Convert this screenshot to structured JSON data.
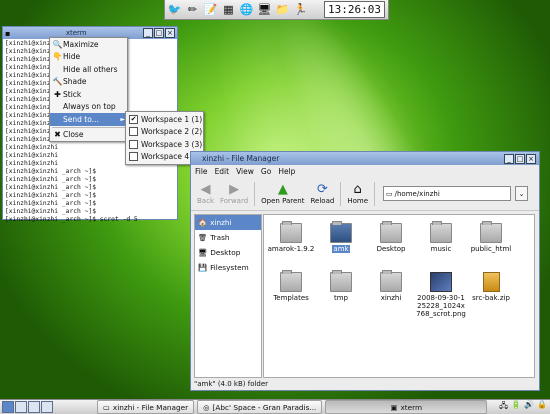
{
  "top_panel": {
    "launchers": [
      {
        "name": "bird-icon",
        "glyph": "🐦"
      },
      {
        "name": "pencil-eraser-icon",
        "glyph": "✏"
      },
      {
        "name": "text-editor-icon",
        "glyph": "📝"
      },
      {
        "name": "calculator-icon",
        "glyph": "▦"
      },
      {
        "name": "globe-icon",
        "glyph": "🌐"
      },
      {
        "name": "monitor-icon",
        "glyph": "🖥"
      },
      {
        "name": "folder-icon",
        "glyph": "📁"
      },
      {
        "name": "runner-icon",
        "glyph": "🏃"
      }
    ],
    "clock": "13:26:03"
  },
  "xterm": {
    "title": "xterm",
    "lines": [
      "[xinzhi@xinzhi",
      "[xinzhi@xinzhi",
      "[xinzhi@xinzhi",
      "[xinzhi@xinzhi",
      "[xinzhi@xinzhi",
      "[xinzhi@xinzhi",
      "[xinzhi@xinzhi",
      "[xinzhi@xinzhi",
      "[xinzhi@xinzhi",
      "[xinzhi@xinzhi",
      "[xinzhi@xinzhi",
      "[xinzhi@xinzhi",
      "[xinzhi@xinzhi",
      "[xinzhi@xinzhi",
      "[xinzhi@xinzhi",
      "[xinzhi@xinzhi",
      "[xinzhi@xinzhi _arch ~]$",
      "[xinzhi@xinzhi _arch ~]$",
      "[xinzhi@xinzhi _arch ~]$",
      "[xinzhi@xinzhi _arch ~]$",
      "[xinzhi@xinzhi _arch ~]$",
      "[xinzhi@xinzhi _arch ~]$",
      "[xinzhi@xinzhi _arch ~]$ scrot -d 5"
    ]
  },
  "window_menu": {
    "items": [
      {
        "label": "Maximize",
        "icon": "maximize-icon",
        "glyph": "🔍"
      },
      {
        "label": "Hide",
        "icon": "hide-icon",
        "glyph": "👇"
      },
      {
        "label": "Hide all others",
        "icon": "hide-others-icon",
        "glyph": ""
      },
      {
        "label": "Shade",
        "icon": "shade-icon",
        "glyph": "🔨"
      },
      {
        "label": "Stick",
        "icon": "stick-icon",
        "glyph": "✚"
      },
      {
        "label": "Always on top",
        "icon": "",
        "glyph": ""
      },
      {
        "label": "Send to...",
        "icon": "",
        "glyph": "",
        "submenu": true,
        "selected": true
      },
      {
        "label": "Close",
        "icon": "close-icon",
        "glyph": "✖",
        "separator_before": true
      }
    ],
    "submenu_arrow": "►"
  },
  "workspace_menu": {
    "items": [
      {
        "label": "Workspace 1 (1)",
        "checked": true
      },
      {
        "label": "Workspace 2 (2)",
        "checked": false
      },
      {
        "label": "Workspace 3 (3)",
        "checked": false
      },
      {
        "label": "Workspace 4 (4)",
        "checked": false
      }
    ]
  },
  "file_manager": {
    "title": "xinzhi - File Manager",
    "menu": [
      "File",
      "Edit",
      "View",
      "Go",
      "Help"
    ],
    "toolbar": {
      "back": "Back",
      "forward": "Forward",
      "open_parent": "Open Parent",
      "reload": "Reload",
      "home": "Home"
    },
    "location": "/home/xinzhi",
    "side_pane": [
      {
        "label": "xinzhi",
        "icon": "home-folder-icon",
        "glyph": "🏠",
        "selected": true
      },
      {
        "label": "Trash",
        "icon": "trash-icon",
        "glyph": "🗑"
      },
      {
        "label": "Desktop",
        "icon": "desktop-icon",
        "glyph": "🖥"
      },
      {
        "label": "Filesystem",
        "icon": "harddisk-icon",
        "glyph": "💾"
      }
    ],
    "files": [
      {
        "name": "amarok-1.9.2",
        "kind": "folder"
      },
      {
        "name": "amk",
        "kind": "folder-selected"
      },
      {
        "name": "Desktop",
        "kind": "folder"
      },
      {
        "name": "music",
        "kind": "folder"
      },
      {
        "name": "public_html",
        "kind": "folder"
      },
      {
        "name": "Templates",
        "kind": "folder"
      },
      {
        "name": "tmp",
        "kind": "folder"
      },
      {
        "name": "xinzhi",
        "kind": "folder"
      },
      {
        "name": "2008-09-30-125228_1024x768_scrot.png",
        "kind": "image"
      },
      {
        "name": "src-bak.zip",
        "kind": "archive"
      }
    ],
    "status": "\"amk\" (4.0 kB) folder"
  },
  "taskbar": {
    "workspaces": 4,
    "current_workspace": 1,
    "tasks": [
      {
        "label": "xinzhi - File Manager",
        "icon": "folder-icon",
        "active": false
      },
      {
        "label": "[Abc' Space - Gran Paradis...",
        "icon": "browser-icon",
        "active": false
      },
      {
        "label": "xterm",
        "icon": "terminal-icon",
        "active": true
      }
    ],
    "tray": [
      {
        "name": "network-icon",
        "glyph": "🖧"
      },
      {
        "name": "power-icon",
        "glyph": "🔋"
      },
      {
        "name": "volume-icon",
        "glyph": "🔊"
      },
      {
        "name": "lock-icon",
        "glyph": "🔒"
      }
    ]
  }
}
